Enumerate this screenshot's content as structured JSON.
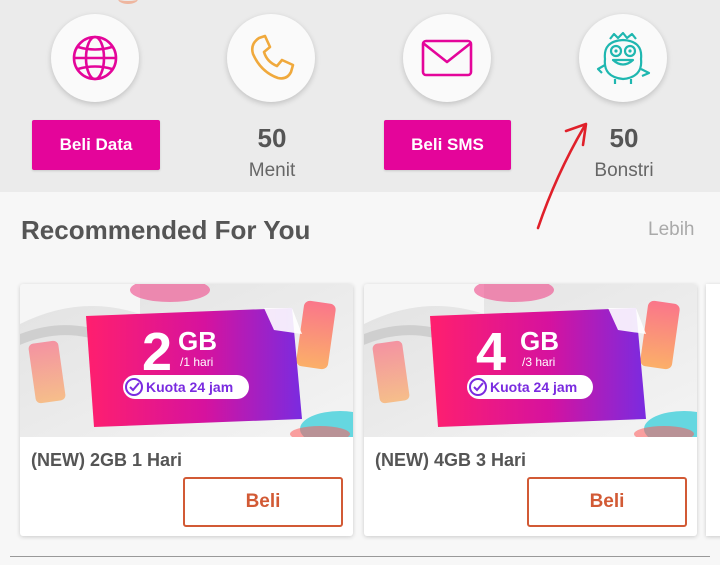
{
  "quick_actions": [
    {
      "icon": "globe-icon",
      "button_label": "Beli Data"
    },
    {
      "icon": "phone-icon",
      "count": "50",
      "unit": "Menit"
    },
    {
      "icon": "envelope-icon",
      "button_label": "Beli SMS"
    },
    {
      "icon": "monster-mascot-icon",
      "count": "50",
      "unit": "Bonstri"
    }
  ],
  "recommended": {
    "title": "Recommended For You",
    "more_label": "Lebih",
    "cards": [
      {
        "banner_amount": "2",
        "banner_unit": "GB",
        "banner_period": "/1 hari",
        "banner_tag": "Kuota 24 jam",
        "title": "(NEW) 2GB 1 Hari",
        "button_label": "Beli"
      },
      {
        "banner_amount": "4",
        "banner_unit": "GB",
        "banner_period": "/3 hari",
        "banner_tag": "Kuota 24 jam",
        "title": "(NEW) 4GB 3 Hari",
        "button_label": "Beli"
      }
    ]
  },
  "colors": {
    "accent_pink": "#e4059a",
    "buy_orange": "#d25a35",
    "annotation_red": "#e0202a"
  }
}
